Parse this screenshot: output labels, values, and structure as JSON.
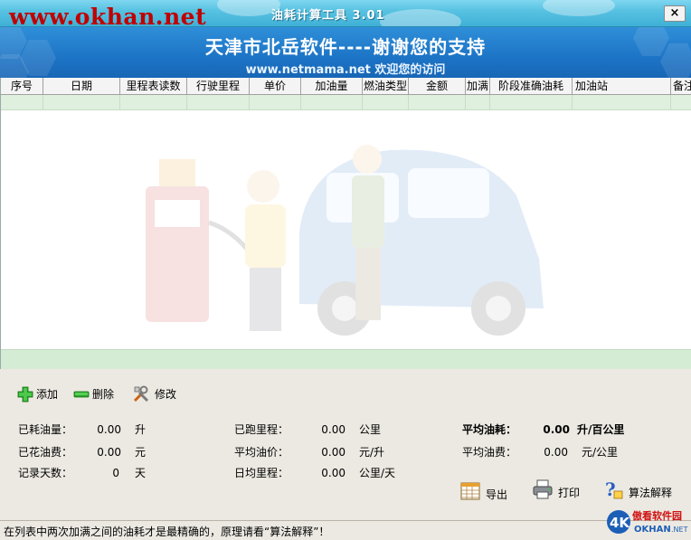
{
  "window": {
    "watermark": "www.okhan.net",
    "title": "油耗计算工具 3.01",
    "close_symbol": "×"
  },
  "banner": {
    "line1": "天津市北岳软件----谢谢您的支持",
    "line2": "www.netmama.net 欢迎您的访问"
  },
  "grid": {
    "columns": [
      "序号",
      "日期",
      "里程表读数",
      "行驶里程",
      "单价",
      "加油量",
      "燃油类型",
      "金额",
      "加满",
      "阶段准确油耗",
      "加油站",
      "备注"
    ]
  },
  "toolbar": {
    "add_label": "添加",
    "delete_label": "删除",
    "edit_label": "修改"
  },
  "stats": {
    "fuel_used": {
      "label": "已耗油量：",
      "value": "0.00",
      "unit": "升"
    },
    "fuel_cost": {
      "label": "已花油费：",
      "value": "0.00",
      "unit": "元"
    },
    "days": {
      "label": "记录天数：",
      "value": "0",
      "unit": "天"
    },
    "distance": {
      "label": "已跑里程：",
      "value": "0.00",
      "unit": "公里"
    },
    "avg_price": {
      "label": "平均油价：",
      "value": "0.00",
      "unit": "元/升"
    },
    "daily_distance": {
      "label": "日均里程：",
      "value": "0.00",
      "unit": "公里/天"
    },
    "avg_consumption": {
      "label": "平均油耗：",
      "value": "0.00",
      "unit": "升/百公里"
    },
    "avg_cost": {
      "label": "平均油费：",
      "value": "0.00",
      "unit": "元/公里"
    }
  },
  "actions": {
    "export_label": "导出",
    "print_label": "打印",
    "algorithm_label": "算法解释"
  },
  "statusbar": {
    "text": "在列表中两次加满之间的油耗才是最精确的，原理请看“算法解释”！"
  },
  "logo": {
    "brand": "4K",
    "name": "傲看软件园",
    "domain": "OKHAN.NET"
  },
  "colors": {
    "banner": "#1d74c6",
    "row_highlight": "#dff0df",
    "panel": "#ece9e2",
    "watermark": "#c00000"
  }
}
